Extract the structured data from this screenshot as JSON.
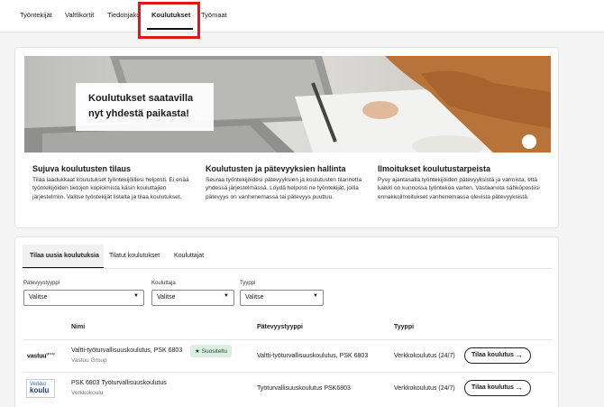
{
  "nav": {
    "tabs": [
      "Työntekijät",
      "Valttikortit",
      "Tiedonjako",
      "Koulutukset",
      "Työmaat"
    ],
    "active_tab": "Koulutukset"
  },
  "hero": {
    "line1": "Koulutukset saatavilla",
    "line2": "nyt yhdestä paikasta!"
  },
  "features": [
    {
      "title": "Sujuva koulutusten tilaus",
      "text": "Tilaa laadukkaat koulutukset työntekijöillesi helposti. Ei enää työntekijöiden tietojen kopioimista käsin kouluttajien järjestelmiin. Valitse työntekijät listalta ja tilaa koulutukset."
    },
    {
      "title": "Koulutusten ja pätevyyksien hallinta",
      "text": "Seuraa työntekijöidesi pätevyyksien ja koulutusten tilannetta yhdessä järjestelmässä. Löydä helposti ne työntekijät, joilla pätevyys on vanhenemassa tai pätevyys puuttuu."
    },
    {
      "title": "Ilmoitukset koulutustarpeista",
      "text": "Pysy ajantasalla työntekijöiden pätevyyksistä ja varmista, että kaikki on kunnossa työntekoa varten. Vastaanota sähköpostiisi ennakkoilmoitukset vanhenemassa olevista pätevyyksistä."
    }
  ],
  "subtabs": [
    "Tilaa uusia koulutuksia",
    "Tilatut koulutukset",
    "Kouluttajat"
  ],
  "filters": [
    {
      "label": "Pätevyystyyppi",
      "value": "Valitse"
    },
    {
      "label": "Kouluttaja",
      "value": "Valitse"
    },
    {
      "label": "Tyyppi",
      "value": "Valitse"
    }
  ],
  "table": {
    "headers": [
      "Nimi",
      "Pätevyystyyppi",
      "Tyyppi"
    ],
    "rows": [
      {
        "provider_logo": "vastuu",
        "provider_logo_sup": "group",
        "name": "Valtti-työturvallisuuskoulutus, PSK 6803",
        "provider": "Vastuu Group",
        "badge": "Suositeltu",
        "qualification": "Valtti-työturvallisuuskoulutus, PSK 6803",
        "type": "Verkkokoulutus (24/7)",
        "button": "Tilaa koulutus"
      },
      {
        "provider_logo": [
          "Verkko",
          "koulu"
        ],
        "name": "PSK 6803 Työturvallisuuskoulutus",
        "provider": "Verkkokoulu",
        "qualification": "Työturvallisuuskoulutus PSK6803",
        "type": "Verkkokoulutus (24/7)",
        "button": "Tilaa koulutus"
      }
    ]
  },
  "colors": {
    "highlight": "#e0161b",
    "badge_bg": "#dceee2",
    "logo_blue": "#2a6bbd"
  }
}
